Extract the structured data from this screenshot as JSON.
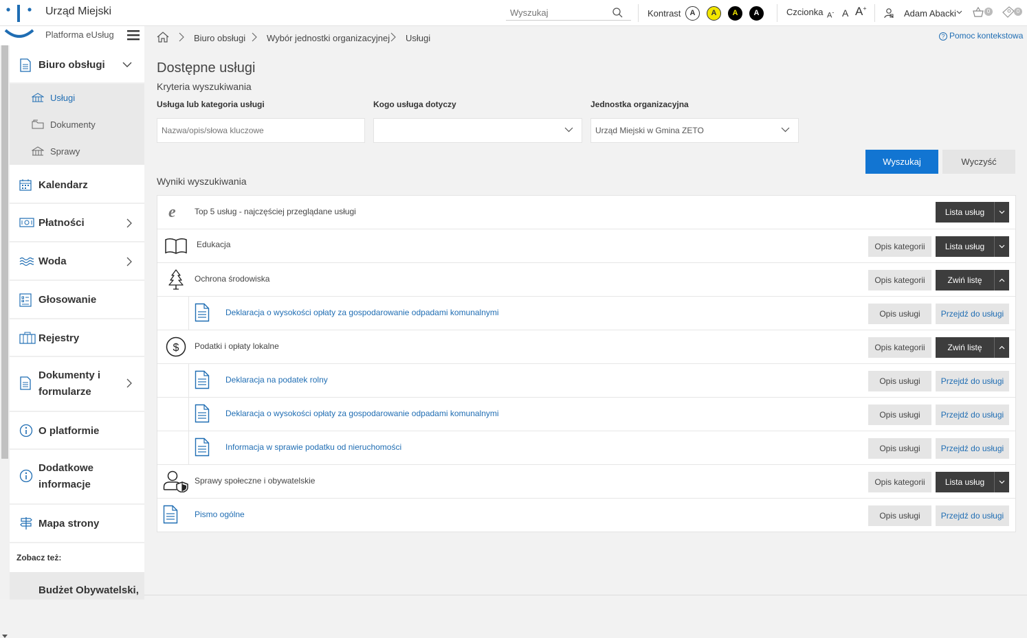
{
  "header": {
    "app_title": "Urząd Miejski",
    "search_placeholder": "Wyszukaj",
    "contrast_label": "Kontrast",
    "contrast_options": [
      "A",
      "A",
      "A",
      "A"
    ],
    "font_label": "Czcionka",
    "font_sizes": [
      {
        "letter": "A",
        "mark": "-"
      },
      {
        "letter": "A",
        "mark": ""
      },
      {
        "letter": "A",
        "mark": "+"
      }
    ],
    "user_name": "Adam Abacki",
    "basket_count": "0",
    "cart_count": "0"
  },
  "sidebar": {
    "platform_label": "Platforma eUsług",
    "items": [
      {
        "label": "Biuro obsługi",
        "icon": "document-icon"
      },
      {
        "label": "Kalendarz",
        "icon": "calendar-icon"
      },
      {
        "label": "Płatności",
        "icon": "money-icon"
      },
      {
        "label": "Woda",
        "icon": "water-icon"
      },
      {
        "label": "Głosowanie",
        "icon": "ballot-icon"
      },
      {
        "label": "Rejestry",
        "icon": "registry-icon"
      },
      {
        "label": "Dokumenty i formularze",
        "label_line1": "Dokumenty i",
        "label_line2": "formularze",
        "icon": "document-icon"
      },
      {
        "label": "O platformie",
        "icon": "info-icon"
      },
      {
        "label": "Dodatkowe informacje",
        "label_line1": "Dodatkowe",
        "label_line2": "informacje",
        "icon": "info-icon"
      },
      {
        "label": "Mapa strony",
        "icon": "signpost-icon"
      }
    ],
    "subitems": [
      {
        "label": "Usługi",
        "icon": "building-icon",
        "active": true
      },
      {
        "label": "Dokumenty",
        "icon": "folder-icon",
        "active": false
      },
      {
        "label": "Sprawy",
        "icon": "building-icon",
        "active": false
      }
    ],
    "see_also_label": "Zobacz też:",
    "see_also_item": "Budżet Obywatelski,"
  },
  "breadcrumb": {
    "items": [
      "Biuro obsługi",
      "Wybór jednostki organizacyjnej",
      "Usługi"
    ]
  },
  "help_link": "Pomoc kontekstowa",
  "main": {
    "title": "Dostępne usługi",
    "criteria_label": "Kryteria wyszukiwania",
    "fields": {
      "service_label": "Usługa lub kategoria usługi",
      "service_placeholder": "Nazwa/opis/słowa kluczowe",
      "target_label": "Kogo usługa dotyczy",
      "target_value": "",
      "unit_label": "Jednostka organizacyjna",
      "unit_value": "Urząd Miejski w Gmina ZETO"
    },
    "search_button": "Wyszukaj",
    "clear_button": "Wyczyść",
    "results_label": "Wyniki wyszukiwania"
  },
  "results": [
    {
      "type": "category",
      "icon": "e-icon",
      "text": "Top 5 usług - najczęściej przeglądane usługi",
      "desc_button": "",
      "list_button": "Lista usług",
      "expanded": false
    },
    {
      "type": "category",
      "icon": "book-icon",
      "text": "Edukacja",
      "desc_button": "Opis kategorii",
      "list_button": "Lista usług",
      "expanded": false
    },
    {
      "type": "category",
      "icon": "tree-icon",
      "text": "Ochrona środowiska",
      "desc_button": "Opis kategorii",
      "list_button": "Zwiń listę",
      "expanded": true
    },
    {
      "type": "service",
      "icon": "document-icon",
      "text": "Deklaracja o wysokości opłaty za gospodarowanie odpadami komunalnymi",
      "desc_button": "Opis usługi",
      "go_button": "Przejdź do usługi"
    },
    {
      "type": "category",
      "icon": "dollar-icon",
      "text": "Podatki i opłaty lokalne",
      "desc_button": "Opis kategorii",
      "list_button": "Zwiń listę",
      "expanded": true
    },
    {
      "type": "service",
      "icon": "document-icon",
      "text": "Deklaracja na podatek rolny",
      "desc_button": "Opis usługi",
      "go_button": "Przejdź do usługi"
    },
    {
      "type": "service",
      "icon": "document-icon",
      "text": "Deklaracja o wysokości opłaty za gospodarowanie odpadami komunalnymi",
      "desc_button": "Opis usługi",
      "go_button": "Przejdź do usługi"
    },
    {
      "type": "service",
      "icon": "document-icon",
      "text": "Informacja w sprawie podatku od nieruchomości",
      "desc_button": "Opis usługi",
      "go_button": "Przejdź do usługi"
    },
    {
      "type": "category",
      "icon": "person-shield-icon",
      "text": "Sprawy społeczne i obywatelskie",
      "desc_button": "Opis kategorii",
      "list_button": "Lista usług",
      "expanded": false
    },
    {
      "type": "toplevel-service",
      "icon": "document-icon",
      "text": "Pismo ogólne",
      "desc_button": "Opis usługi",
      "go_button": "Przejdź do usługi"
    }
  ],
  "colors": {
    "accent_blue": "#1275d2",
    "link_blue": "#1f6db3",
    "dark_button": "#3d3d3d",
    "contrast_yellow": "#f2e600"
  }
}
